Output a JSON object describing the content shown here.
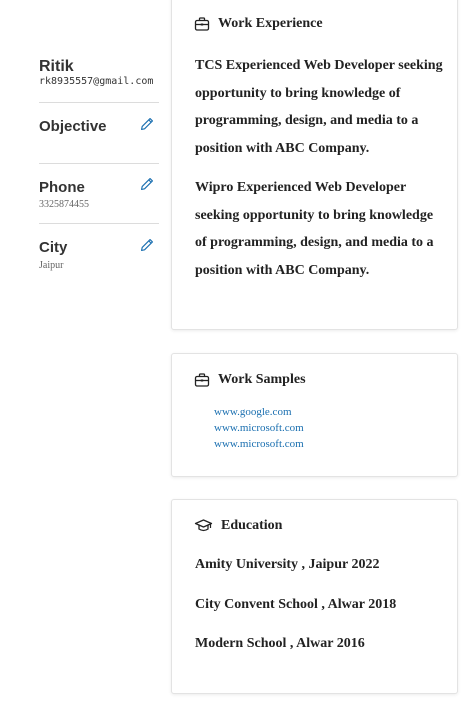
{
  "profile": {
    "name": "Ritik",
    "email": "rk8935557@gmail.com"
  },
  "sidebar": {
    "objective_label": "Objective",
    "phone_label": "Phone",
    "phone_value": "3325874455",
    "city_label": "City",
    "city_value": "Jaipur"
  },
  "work_experience": {
    "title": "Work Experience",
    "entries": [
      "TCS Experienced Web Developer seeking opportunity to bring knowledge of programming, design, and media to a position with ABC Company.",
      "Wipro Experienced Web Developer seeking opportunity to bring knowledge of programming, design, and media to a position with ABC Company."
    ]
  },
  "work_samples": {
    "title": "Work Samples",
    "links": [
      "www.google.com",
      "www.microsoft.com",
      "www.microsoft.com"
    ]
  },
  "education": {
    "title": "Education",
    "items": [
      "Amity University , Jaipur 2022",
      "City Convent School , Alwar 2018",
      "Modern School , Alwar 2016"
    ]
  },
  "colors": {
    "accent": "#1a6fb0",
    "edit_icon": "#1a6fb0"
  },
  "icons": {
    "work_experience": "briefcase-icon",
    "work_samples": "briefcase-icon",
    "education": "graduation-cap-icon",
    "edit": "pencil-icon"
  }
}
